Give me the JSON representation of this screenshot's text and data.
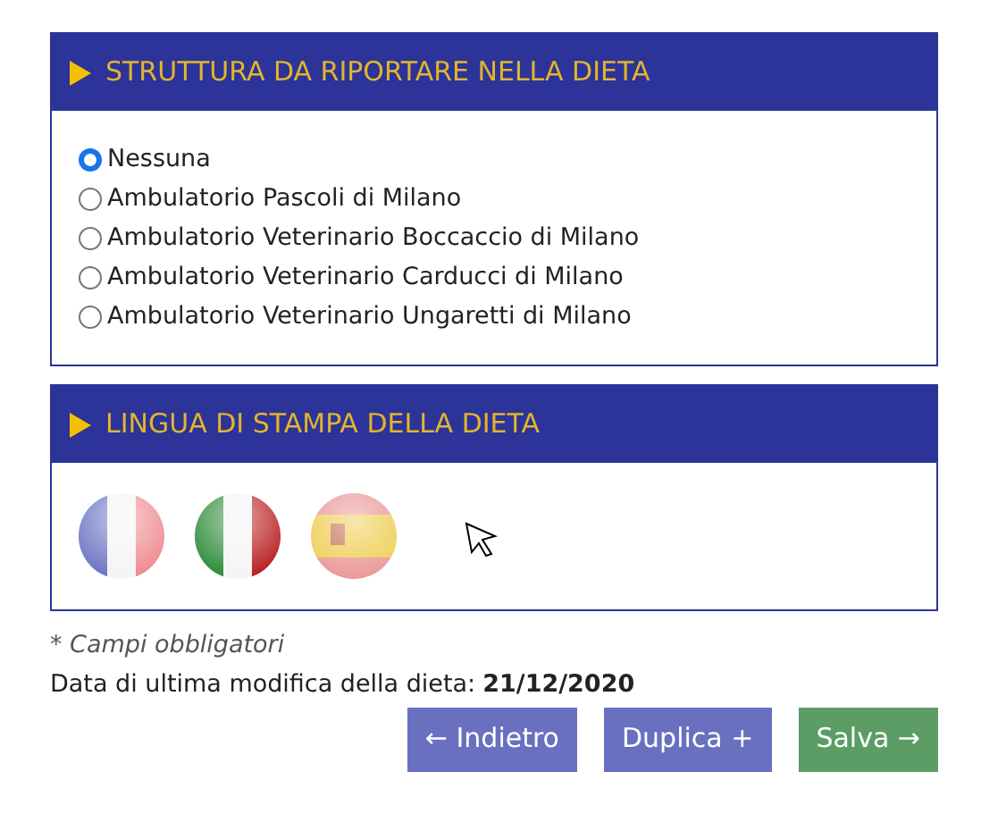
{
  "structure_panel": {
    "title": "STRUTTURA DA RIPORTARE NELLA DIETA",
    "options": [
      {
        "label": "Nessuna",
        "selected": true
      },
      {
        "label": "Ambulatorio Pascoli di Milano",
        "selected": false
      },
      {
        "label": "Ambulatorio Veterinario Boccaccio di Milano",
        "selected": false
      },
      {
        "label": "Ambulatorio Veterinario Carducci di Milano",
        "selected": false
      },
      {
        "label": "Ambulatorio Veterinario Ungaretti di Milano",
        "selected": false
      }
    ]
  },
  "language_panel": {
    "title": "LINGUA DI STAMPA DELLA DIETA",
    "flags": [
      {
        "kind": "france"
      },
      {
        "kind": "italy"
      },
      {
        "kind": "spain"
      }
    ]
  },
  "required_note": "* Campi obbligatori",
  "last_modified": {
    "label": "Data di ultima modifica della dieta:",
    "date": "21/12/2020"
  },
  "buttons": [
    {
      "label": "← Indietro",
      "kind": "back"
    },
    {
      "label": "Duplica +",
      "kind": "duplicate"
    },
    {
      "label": "Salva →",
      "kind": "save"
    }
  ]
}
